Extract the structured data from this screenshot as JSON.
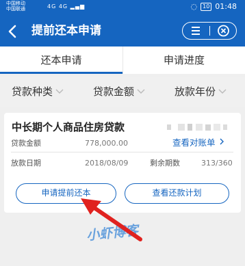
{
  "status_bar": {
    "carrier1": "中国移动",
    "carrier2": "中国联通",
    "signal": "4G 4G",
    "battery": "10",
    "time": "01:48"
  },
  "header": {
    "title": "提前还本申请",
    "back_icon": "chevron-left-icon",
    "menu_icon": "menu-icon",
    "close_icon": "close-circle-icon"
  },
  "tabs": [
    {
      "label": "还本申请",
      "active": true
    },
    {
      "label": "申请进度",
      "active": false
    }
  ],
  "filters": [
    {
      "label": "贷款种类"
    },
    {
      "label": "贷款金额"
    },
    {
      "label": "放款年份"
    }
  ],
  "loan_card": {
    "product_name": "中长期个人商品住房贷款",
    "amount_label": "贷款金额",
    "amount_value": "778,000.00",
    "statement_link": "查看对账单",
    "date_label": "放款日期",
    "date_value": "2018/08/09",
    "remaining_label": "剩余期数",
    "remaining_value": "313/360",
    "apply_button": "申请提前还本",
    "plan_button": "查看还款计划"
  },
  "watermark": "小虾博客",
  "colors": {
    "primary": "#1565c0",
    "arrow": "#e0221f"
  }
}
